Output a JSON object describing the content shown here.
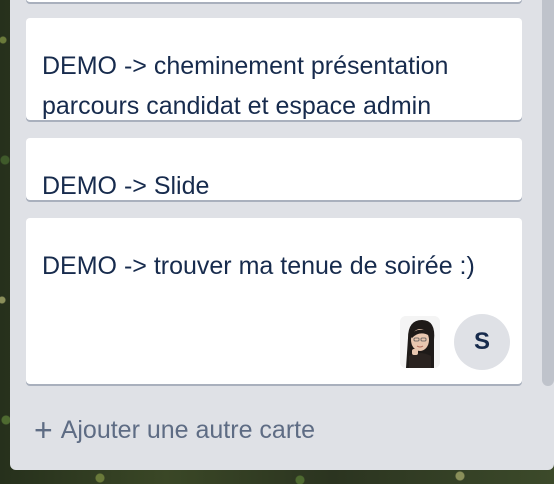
{
  "cards": [
    {
      "title": "DEMO -> cheminement présentation parcours candidat et espace admin"
    },
    {
      "title": "DEMO -> Slide"
    },
    {
      "title": "DEMO -> trouver ma tenue de soirée :)",
      "members": [
        {
          "initial": "S"
        }
      ]
    }
  ],
  "add_card": {
    "label": "Ajouter une autre carte",
    "icon": "plus-icon"
  },
  "colors": {
    "list_bg": "#dfe1e6",
    "card_bg": "#ffffff",
    "text": "#172b4d",
    "muted": "#5e6c84"
  }
}
